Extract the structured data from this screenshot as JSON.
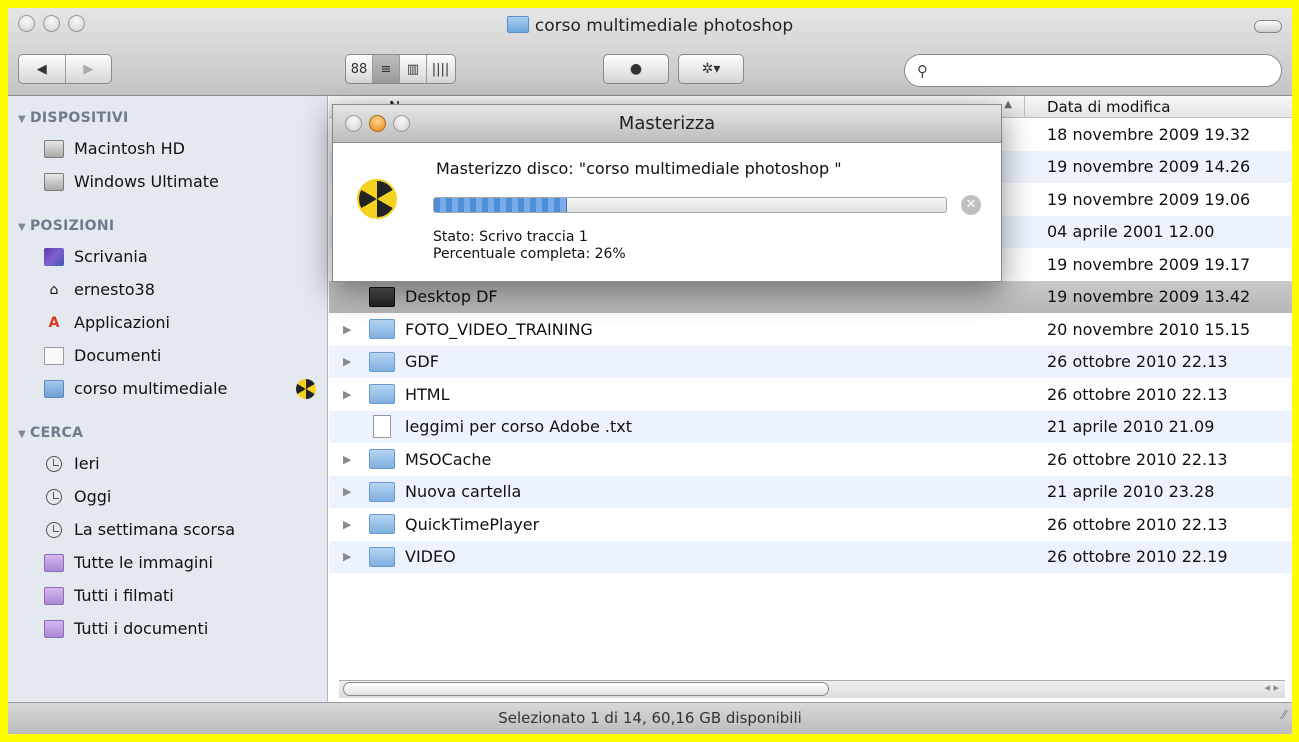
{
  "window": {
    "title": "corso multimediale photoshop"
  },
  "toolbar": {
    "back_label": "◀",
    "forward_label": "▶",
    "view_icons": "88",
    "view_list": "≡",
    "view_columns": "▥",
    "view_coverflow": "||||",
    "quicklook": "●",
    "action": "✲▾",
    "search_placeholder": ""
  },
  "sidebar": {
    "sections": [
      {
        "title": "DISPOSITIVI",
        "items": [
          {
            "label": "Macintosh HD",
            "icon": "hard-drive-icon"
          },
          {
            "label": "Windows Ultimate",
            "icon": "hard-drive-icon"
          }
        ]
      },
      {
        "title": "POSIZIONI",
        "items": [
          {
            "label": "Scrivania",
            "icon": "desktop-icon"
          },
          {
            "label": "ernesto38",
            "icon": "home-icon"
          },
          {
            "label": "Applicazioni",
            "icon": "applications-icon"
          },
          {
            "label": "Documenti",
            "icon": "documents-icon"
          },
          {
            "label": "corso multimediale",
            "icon": "disc-folder-icon",
            "burning": true
          }
        ]
      },
      {
        "title": "CERCA",
        "items": [
          {
            "label": "Ieri",
            "icon": "clock-icon"
          },
          {
            "label": "Oggi",
            "icon": "clock-icon"
          },
          {
            "label": "La settimana scorsa",
            "icon": "clock-icon"
          },
          {
            "label": "Tutte le immagini",
            "icon": "smart-folder-icon"
          },
          {
            "label": "Tutti i filmati",
            "icon": "smart-folder-icon"
          },
          {
            "label": "Tutti i documenti",
            "icon": "smart-folder-icon"
          }
        ]
      }
    ]
  },
  "list": {
    "columns": {
      "name": "N",
      "date": "Data di modifica"
    },
    "rows": [
      {
        "name": "",
        "date": "18 novembre 2009 19.32"
      },
      {
        "name": "",
        "date": "19 novembre 2009 14.26"
      },
      {
        "name": "",
        "date": "19 novembre 2009 19.06"
      },
      {
        "name": "",
        "date": "04 aprile 2001 12.00"
      },
      {
        "name": "",
        "date": "19 novembre 2009 19.17"
      },
      {
        "name": "Desktop DF",
        "date": "19 novembre 2009 13.42",
        "type": "dark-folder",
        "selected": true
      },
      {
        "name": "FOTO_VIDEO_TRAINING",
        "date": "20 novembre 2010 15.15",
        "type": "folder"
      },
      {
        "name": "GDF",
        "date": "26 ottobre 2010 22.13",
        "type": "folder"
      },
      {
        "name": "HTML",
        "date": "26 ottobre 2010 22.13",
        "type": "folder"
      },
      {
        "name": "leggimi per corso Adobe .txt",
        "date": "21 aprile 2010 21.09",
        "type": "text"
      },
      {
        "name": "MSOCache",
        "date": "26 ottobre 2010 22.13",
        "type": "folder"
      },
      {
        "name": "Nuova cartella",
        "date": "21 aprile 2010 23.28",
        "type": "folder"
      },
      {
        "name": "QuickTimePlayer",
        "date": "26 ottobre 2010 22.13",
        "type": "folder"
      },
      {
        "name": "VIDEO",
        "date": "26 ottobre 2010 22.19",
        "type": "folder"
      }
    ]
  },
  "status": {
    "text": "Selezionato 1 di 14, 60,16 GB disponibili"
  },
  "dialog": {
    "title": "Masterizza",
    "message": "Masterizzo disco: \"corso multimediale photoshop \"",
    "progress": 0.26,
    "status_line": "Stato: Scrivo traccia 1",
    "percent_line": "Percentuale completa: 26%"
  },
  "colors": {
    "border_highlight": "#ffff00",
    "sidebar_bg": "#e4e9f0",
    "alt_row": "#edf3fe",
    "progress_blue": "#4f8ed8"
  }
}
